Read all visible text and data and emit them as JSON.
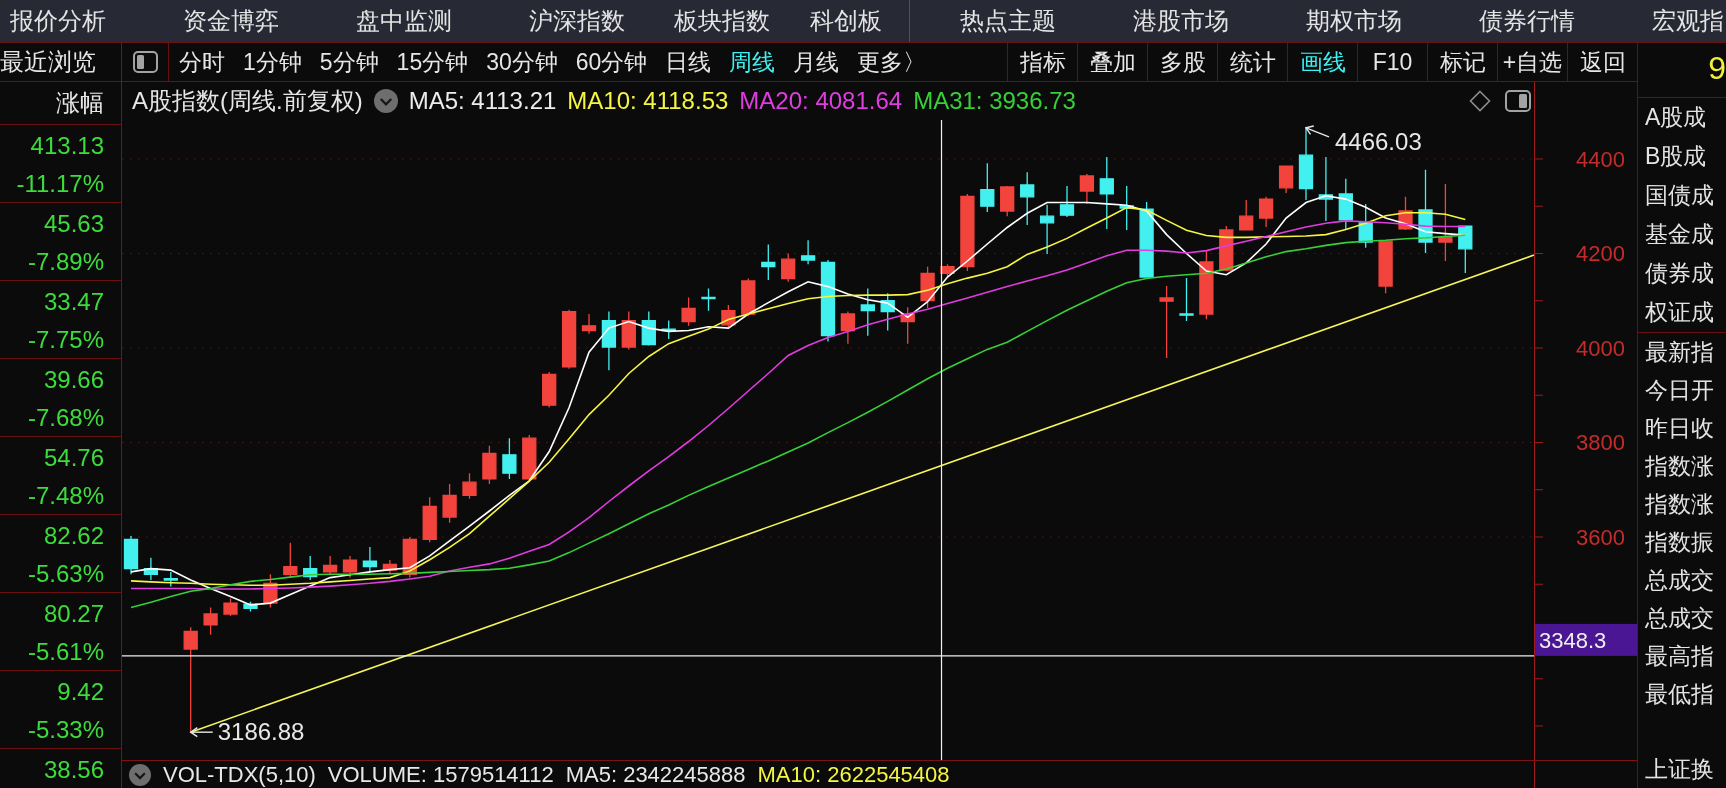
{
  "menu_bar": {
    "groups": [
      {
        "items": [
          "报价分析",
          "资金博弈",
          "盘中监测",
          "沪深指数",
          "板块指数",
          "科创板"
        ]
      },
      {
        "items": [
          "热点主题",
          "港股市场",
          "期权市场",
          "债券行情",
          "宏观指"
        ]
      }
    ]
  },
  "recent_button": {
    "label": "最近浏览"
  },
  "period_tabs": [
    {
      "label": "分时",
      "selected": false
    },
    {
      "label": "1分钟",
      "selected": false
    },
    {
      "label": "5分钟",
      "selected": false
    },
    {
      "label": "15分钟",
      "selected": false
    },
    {
      "label": "30分钟",
      "selected": false
    },
    {
      "label": "60分钟",
      "selected": false
    },
    {
      "label": "日线",
      "selected": false
    },
    {
      "label": "周线",
      "selected": true
    },
    {
      "label": "月线",
      "selected": false
    },
    {
      "label": "更多〉",
      "selected": false
    }
  ],
  "tool_buttons": [
    {
      "label": "指标",
      "on": false
    },
    {
      "label": "叠加",
      "on": false
    },
    {
      "label": "多股",
      "on": false
    },
    {
      "label": "统计",
      "on": false
    },
    {
      "label": "画线",
      "on": true
    },
    {
      "label": "F10",
      "on": false
    },
    {
      "label": "标记",
      "on": false
    },
    {
      "label": "+自选",
      "on": false
    },
    {
      "label": "返回",
      "on": false
    }
  ],
  "left_list": {
    "header": "涨幅",
    "rows": [
      {
        "value": "413.13",
        "change": "-11.17%"
      },
      {
        "value": "45.63",
        "change": "-7.89%"
      },
      {
        "value": "33.47",
        "change": "-7.75%"
      },
      {
        "value": "39.66",
        "change": "-7.68%"
      },
      {
        "value": "54.76",
        "change": "-7.48%"
      },
      {
        "value": "82.62",
        "change": "-5.63%"
      },
      {
        "value": "80.27",
        "change": "-5.61%"
      },
      {
        "value": "9.42",
        "change": "-5.33%"
      },
      {
        "value": "38.56"
      }
    ]
  },
  "chart": {
    "legend": [
      {
        "label": "MA5: 4113.21",
        "color": "#ececec"
      },
      {
        "label": "MA10: 4118.53",
        "color": "#f5f542"
      },
      {
        "label": "MA20: 4081.64",
        "color": "#e03ce0"
      },
      {
        "label": "MA31: 3936.73",
        "color": "#38d038"
      }
    ],
    "chart_data": {
      "type": "line",
      "title": "A股指数(周线.前复权)",
      "ylim": [
        3128,
        4482.5
      ],
      "yticks": [
        3600,
        3800,
        4000,
        4200,
        4400
      ],
      "grid": true,
      "series": [
        {
          "type": "candlestick",
          "ohlc": [
            [
              3595,
              3602,
              3521,
              3533
            ],
            [
              3533,
              3556,
              3509,
              3521
            ],
            [
              3512,
              3526,
              3495,
              3509
            ],
            [
              3363,
              3409,
              3186.88,
              3400
            ],
            [
              3414,
              3451,
              3393,
              3437
            ],
            [
              3437,
              3470,
              3433,
              3460
            ],
            [
              3458,
              3463,
              3442,
              3449
            ],
            [
              3460,
              3521,
              3451,
              3502
            ],
            [
              3521,
              3588,
              3514,
              3537
            ],
            [
              3533,
              3560,
              3509,
              3516
            ],
            [
              3526,
              3560,
              3519,
              3540
            ],
            [
              3526,
              3560,
              3514,
              3551
            ],
            [
              3549,
              3579,
              3526,
              3537
            ],
            [
              3530,
              3551,
              3521,
              3542
            ],
            [
              3521,
              3600,
              3514,
              3595
            ],
            [
              3595,
              3684,
              3589,
              3665
            ],
            [
              3642,
              3712,
              3630,
              3688
            ],
            [
              3688,
              3735,
              3681,
              3716
            ],
            [
              3723,
              3793,
              3712,
              3777
            ],
            [
              3774,
              3809,
              3723,
              3735
            ],
            [
              3723,
              3816,
              3716,
              3809
            ],
            [
              3879,
              3949,
              3874,
              3944
            ],
            [
              3960,
              4081,
              3956,
              4077
            ],
            [
              4037,
              4072,
              4030,
              4047
            ],
            [
              4058,
              4077,
              3953,
              4002
            ],
            [
              4002,
              4077,
              3997,
              4058
            ],
            [
              4058,
              4077,
              4005,
              4007
            ],
            [
              4040,
              4058,
              4019,
              4037
            ],
            [
              4056,
              4107,
              4047,
              4084
            ],
            [
              4107,
              4126,
              4079,
              4105
            ],
            [
              4049,
              4091,
              4042,
              4079
            ],
            [
              4072,
              4147,
              4067,
              4142
            ],
            [
              4181,
              4219,
              4144,
              4172
            ],
            [
              4147,
              4200,
              4140,
              4188
            ],
            [
              4195,
              4228,
              4177,
              4186
            ],
            [
              4181,
              4186,
              4014,
              4026
            ],
            [
              4037,
              4077,
              4009,
              4072
            ],
            [
              4091,
              4126,
              4026,
              4079
            ],
            [
              4100,
              4116,
              4037,
              4077
            ],
            [
              4056,
              4086,
              4009,
              4072
            ],
            [
              4100,
              4172,
              4084,
              4158
            ],
            [
              4158,
              4177,
              4151,
              4172
            ],
            [
              4172,
              4326,
              4163,
              4321
            ],
            [
              4335,
              4391,
              4288,
              4300
            ],
            [
              4290,
              4343,
              4279,
              4341
            ],
            [
              4345,
              4372,
              4260,
              4320
            ],
            [
              4279,
              4303,
              4199,
              4265
            ],
            [
              4303,
              4343,
              4277,
              4281
            ],
            [
              4332,
              4368,
              4305,
              4364
            ],
            [
              4358,
              4404,
              4252,
              4326
            ],
            [
              4301,
              4343,
              4250,
              4296
            ],
            [
              4294,
              4309,
              4150,
              4150
            ],
            [
              4099,
              4131,
              3979,
              4106
            ],
            [
              4072,
              4148,
              4057,
              4070
            ],
            [
              4072,
              4207,
              4061,
              4182
            ],
            [
              4165,
              4258,
              4163,
              4250
            ],
            [
              4250,
              4313,
              4250,
              4279
            ],
            [
              4275,
              4320,
              4256,
              4315
            ],
            [
              4339,
              4385,
              4328,
              4385
            ],
            [
              4408,
              4466.03,
              4313,
              4337
            ],
            [
              4324,
              4404,
              4269,
              4315
            ],
            [
              4326,
              4358,
              4252,
              4271
            ],
            [
              4265,
              4305,
              4212,
              4224
            ],
            [
              4131,
              4226,
              4116,
              4226
            ],
            [
              4252,
              4320,
              4250,
              4290
            ],
            [
              4292,
              4377,
              4201,
              4224
            ],
            [
              4224,
              4347,
              4184,
              4234
            ],
            [
              4258,
              4258,
              4159,
              4210
            ]
          ]
        },
        {
          "color": "#ffffff",
          "values": [
            3526,
            3533,
            3530,
            3509,
            3491,
            3474,
            3456,
            3460,
            3478,
            3496,
            3514,
            3520,
            3526,
            3531,
            3535,
            3560,
            3592,
            3623,
            3655,
            3688,
            3719,
            3781,
            3874,
            3991,
            4042,
            4056,
            4042,
            4035,
            4037,
            4045,
            4042,
            4072,
            4096,
            4119,
            4140,
            4130,
            4114,
            4102,
            4095,
            4065,
            4098,
            4150,
            4184,
            4220,
            4255,
            4285,
            4308,
            4308,
            4308,
            4305,
            4302,
            4290,
            4240,
            4200,
            4163,
            4155,
            4180,
            4220,
            4275,
            4308,
            4322,
            4315,
            4298,
            4275,
            4263,
            4246,
            4242,
            4239
          ]
        },
        {
          "color": "#f5f542",
          "values": [
            3507,
            3505,
            3503,
            3502,
            3500,
            3499,
            3498,
            3498,
            3500,
            3502,
            3505,
            3508,
            3511,
            3514,
            3528,
            3552,
            3578,
            3607,
            3644,
            3681,
            3718,
            3758,
            3808,
            3859,
            3900,
            3946,
            3982,
            4009,
            4025,
            4040,
            4060,
            4072,
            4083,
            4094,
            4104,
            4109,
            4111,
            4112,
            4112,
            4113,
            4122,
            4136,
            4148,
            4158,
            4172,
            4198,
            4214,
            4232,
            4254,
            4275,
            4297,
            4292,
            4270,
            4249,
            4238,
            4234,
            4234,
            4235,
            4236,
            4237,
            4240,
            4251,
            4264,
            4280,
            4286,
            4286,
            4283,
            4272
          ]
        },
        {
          "color": "#e03ce0",
          "values": [
            3491,
            3491,
            3491,
            3491,
            3490,
            3490,
            3490,
            3491,
            3492,
            3494,
            3496,
            3499,
            3502,
            3506,
            3511,
            3517,
            3528,
            3536,
            3543,
            3555,
            3570,
            3584,
            3611,
            3641,
            3675,
            3708,
            3740,
            3770,
            3802,
            3836,
            3872,
            3909,
            3946,
            3984,
            4005,
            4022,
            4035,
            4049,
            4061,
            4072,
            4082,
            4094,
            4106,
            4118,
            4130,
            4142,
            4153,
            4165,
            4180,
            4195,
            4207,
            4207,
            4205,
            4201,
            4206,
            4216,
            4226,
            4236,
            4246,
            4256,
            4264,
            4269,
            4267,
            4265,
            4262,
            4258,
            4257,
            4257
          ]
        },
        {
          "color": "#38d038",
          "values": [
            3451,
            3462,
            3474,
            3485,
            3491,
            3499,
            3506,
            3510,
            3515,
            3520,
            3521,
            3521,
            3521,
            3522,
            3523,
            3525,
            3527,
            3529,
            3531,
            3534,
            3541,
            3549,
            3567,
            3587,
            3607,
            3628,
            3649,
            3668,
            3688,
            3707,
            3725,
            3743,
            3761,
            3780,
            3799,
            3821,
            3842,
            3864,
            3887,
            3911,
            3935,
            3957,
            3977,
            3997,
            4012,
            4035,
            4058,
            4080,
            4100,
            4120,
            4138,
            4147,
            4152,
            4155,
            4158,
            4167,
            4180,
            4193,
            4204,
            4210,
            4217,
            4223,
            4226,
            4228,
            4231,
            4233,
            4236,
            4239
          ]
        }
      ],
      "annotations": [
        "4466.03",
        "3186.88"
      ],
      "ref_lines": [
        {
          "axis": "y",
          "value": 3348.3,
          "label": "3348.3"
        }
      ]
    }
  },
  "volume_panel": {
    "legend": [
      {
        "label": "VOL-TDX(5,10)",
        "color": "#e8e8e8"
      },
      {
        "label": "VOLUME: 1579514112",
        "color": "#e8e8e8"
      },
      {
        "label": "MA5: 2342245888",
        "color": "#e8e8e8"
      },
      {
        "label": "MA10: 2622545408",
        "color": "#f5f542"
      }
    ]
  },
  "right_panel": {
    "top_value": "9",
    "sections": [
      {
        "items": [
          "A股成",
          "B股成",
          "国债成",
          "基金成",
          "债券成",
          "权证成"
        ]
      },
      {
        "items": [
          "最新指",
          "今日开",
          "昨日收",
          "指数涨",
          "指数涨",
          "指数振",
          "总成交",
          "总成交",
          "最高指",
          "最低指"
        ]
      },
      {
        "items": [
          "上证换"
        ]
      }
    ]
  }
}
